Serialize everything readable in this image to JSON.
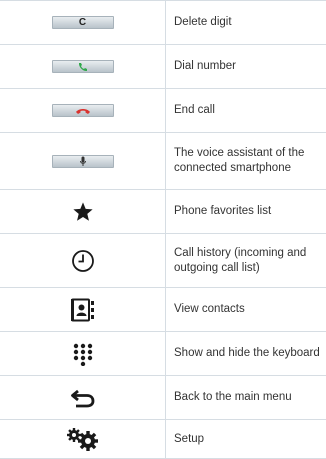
{
  "rows": [
    {
      "icon": "c-key-icon",
      "key_label": "C",
      "desc": "Delete digit"
    },
    {
      "icon": "dial-key-icon",
      "desc": "Dial number"
    },
    {
      "icon": "end-call-key-icon",
      "desc": "End call"
    },
    {
      "icon": "voice-assistant-key-icon",
      "desc": "The voice assistant of the connected smartphone"
    },
    {
      "icon": "star-icon",
      "desc": "Phone favorites list"
    },
    {
      "icon": "clock-icon",
      "desc": "Call history (incoming and outgoing call list)"
    },
    {
      "icon": "contacts-icon",
      "desc": "View contacts"
    },
    {
      "icon": "keypad-icon",
      "desc": "Show and hide the keyboard"
    },
    {
      "icon": "back-arrow-icon",
      "desc": "Back to the main menu"
    },
    {
      "icon": "settings-gears-icon",
      "desc": "Setup"
    }
  ],
  "colors": {
    "dial_green": "#2fa84a",
    "end_red": "#d9332f",
    "icon_dark": "#1a1a1a"
  }
}
